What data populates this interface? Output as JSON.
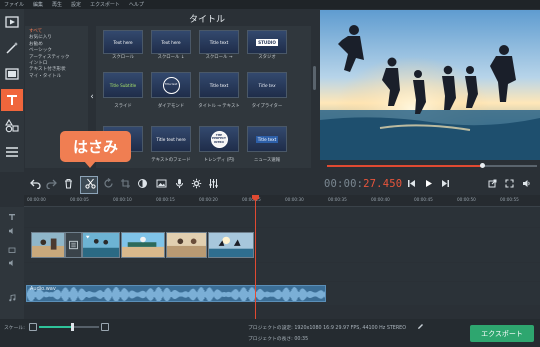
{
  "menu": [
    "ファイル",
    "編集",
    "再生",
    "設定",
    "エクスポート",
    "ヘルプ"
  ],
  "rail_tools": [
    "media-import-icon",
    "magic-wand-icon",
    "clip-filter-icon",
    "title-text-icon",
    "shapes-icon",
    "list-icon"
  ],
  "categories": {
    "items": [
      "すべて",
      "お気に入り",
      "お勧め",
      "ベーシック",
      "アーティスティック",
      "イントロ",
      "テキスト付き形状",
      "マイ・タイトル"
    ],
    "selected_index": 0
  },
  "gallery": {
    "heading": "タイトル",
    "thumbs": [
      {
        "text": "Text here",
        "label": "スクロール"
      },
      {
        "text": "Text here",
        "label": "スクロール ↓"
      },
      {
        "text": "Title text",
        "label": "スクロール →"
      },
      {
        "text": "STUDIO",
        "label": "スタジオ"
      },
      {
        "text": "Title Subtitle",
        "label": "スライド"
      },
      {
        "text": "Title text",
        "label": "ダイアモンド"
      },
      {
        "text": "Title text",
        "label": "タイトル → テキスト"
      },
      {
        "text": "Title tex",
        "label": "タイプライター"
      },
      {
        "text": "",
        "label": ""
      },
      {
        "text": "Title text here",
        "label": "テキストのフェード"
      },
      {
        "text": "THE PERFECT INTRO",
        "label": "トレンディ (円)"
      },
      {
        "text": "Title text",
        "label": "ニュース速報"
      }
    ]
  },
  "tooltip": "はさみ",
  "preview": {
    "progress": 0.74
  },
  "timecode": {
    "main": "00:00:",
    "fraction": "27.450"
  },
  "timeline": {
    "ruler": [
      "00:00:00",
      "00:00:05",
      "00:00:10",
      "00:00:15",
      "00:00:20",
      "00:00:25",
      "00:00:30",
      "00:00:35",
      "00:00:40",
      "00:00:45",
      "00:00:50",
      "00:00:55"
    ],
    "audio_clip": "Audio.wav"
  },
  "status": {
    "zoom_label": "スケール:",
    "zoom_level": 0.55,
    "project_settings": "プロジェクトの設定:  1920x1080 16:9 29.97 FPS, 44100 Hz STEREO",
    "project_length": "プロジェクトの長さ:  00:35",
    "export_label": "エクスポート"
  },
  "colors": {
    "accent": "#f0663c",
    "playhead": "#e04a32",
    "export": "#2ea66f",
    "audio": "#3b6e96"
  }
}
